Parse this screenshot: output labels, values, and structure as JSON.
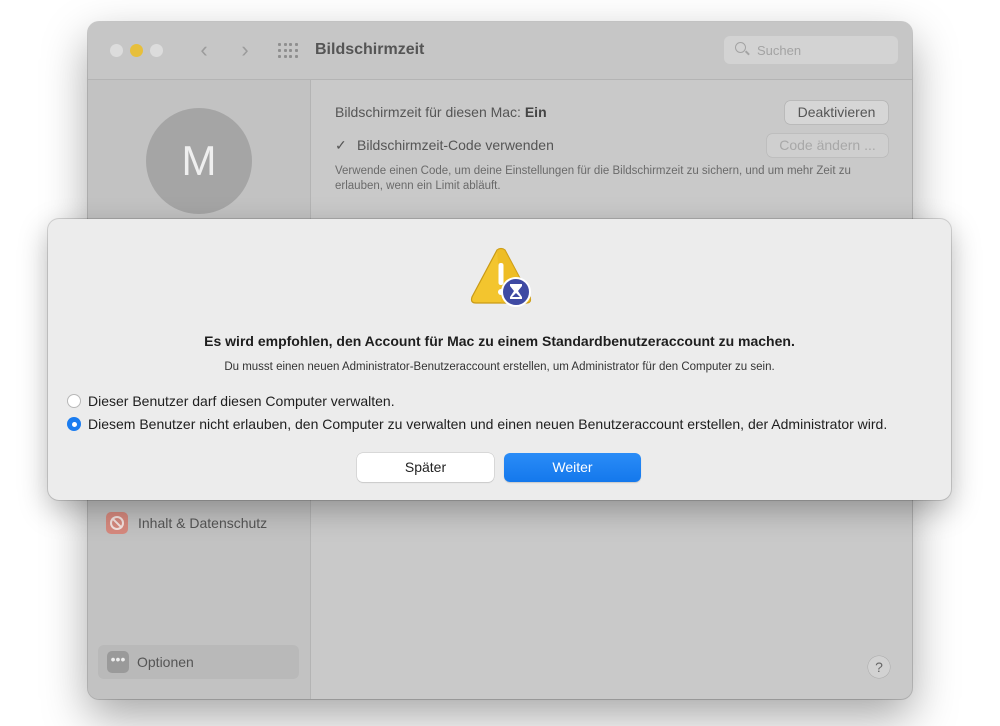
{
  "window": {
    "title": "Bildschirmzeit",
    "search_placeholder": "Suchen"
  },
  "sidebar": {
    "avatar_initial": "M",
    "items": [
      {
        "label": "Inhalt & Datenschutz",
        "icon": "restriction-icon"
      }
    ],
    "options_label": "Optionen",
    "options_icon": "ellipsis-icon"
  },
  "main": {
    "status_label": "Bildschirmzeit für diesen Mac:",
    "status_value": "Ein",
    "deactivate_label": "Deaktivieren",
    "code_checkbox_label": "Bildschirmzeit-Code verwenden",
    "code_checked": true,
    "change_code_label": "Code ändern ...",
    "description": "Verwende einen Code, um deine Einstellungen für die Bildschirmzeit zu sichern, und um mehr Zeit zu erlauben, wenn ein Limit abläuft.",
    "help_label": "?"
  },
  "dialog": {
    "icon": "warning-hourglass-icon",
    "headline": "Es wird empfohlen, den Account für Mac zu einem Standardbenutzeraccount zu machen.",
    "subline": "Du musst einen neuen Administrator-Benutzeraccount erstellen, um Administrator für den Computer zu sein.",
    "options": [
      {
        "label": "Dieser Benutzer darf diesen Computer verwalten.",
        "selected": false
      },
      {
        "label": "Diesem Benutzer nicht erlauben, den Computer zu verwalten und einen neuen Benutzeraccount erstellen, der Administrator wird.",
        "selected": true
      }
    ],
    "later_label": "Später",
    "continue_label": "Weiter"
  },
  "colors": {
    "accent": "#1a7cf0",
    "traffic_light_minimize": "#e7bf3b",
    "warning_yellow": "#f3c52e",
    "hourglass_badge": "#3f4aa3"
  }
}
